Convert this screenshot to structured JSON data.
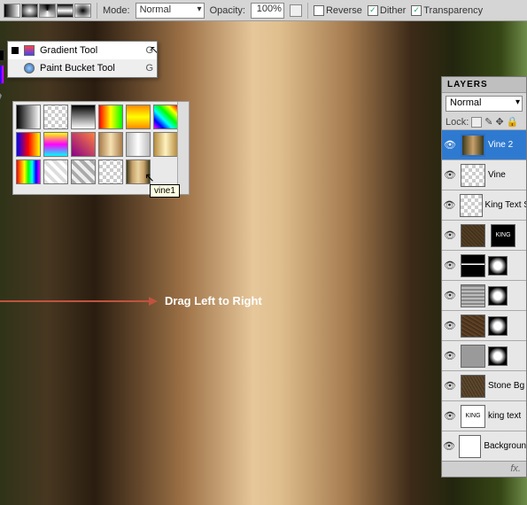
{
  "optionsBar": {
    "modeLabel": "Mode:",
    "modeValue": "Normal",
    "opacityLabel": "Opacity:",
    "opacityValue": "100%",
    "reverse": {
      "label": "Reverse",
      "checked": false
    },
    "dither": {
      "label": "Dither",
      "checked": true
    },
    "transparency": {
      "label": "Transparency",
      "checked": true
    }
  },
  "toolFlyout": {
    "items": [
      {
        "label": "Gradient Tool",
        "shortcut": "G",
        "selected": true
      },
      {
        "label": "Paint Bucket Tool",
        "shortcut": "G",
        "selected": false
      }
    ]
  },
  "gradientTooltip": "vine1",
  "annotation": "Drag Left to Right",
  "layersPanel": {
    "title": "LAYERS",
    "blendMode": "Normal",
    "lockLabel": "Lock:",
    "layers": [
      {
        "name": "Vine 2",
        "active": true,
        "thumb": "th-vine2",
        "mask": false
      },
      {
        "name": "Vine",
        "active": false,
        "thumb": "th-vine",
        "mask": false
      },
      {
        "name": "King Text S",
        "active": false,
        "thumb": "th-king",
        "mask": false
      },
      {
        "name": "",
        "active": false,
        "thumb": "th-tex1",
        "mask": true,
        "mask2": "th-kingb"
      },
      {
        "name": "",
        "active": false,
        "thumb": "th-bar",
        "mask": true
      },
      {
        "name": "",
        "active": false,
        "thumb": "th-lines",
        "mask": true
      },
      {
        "name": "",
        "active": false,
        "thumb": "th-tex2",
        "mask": true
      },
      {
        "name": "",
        "active": false,
        "thumb": "th-gray",
        "mask": true
      },
      {
        "name": "Stone Bg",
        "active": false,
        "thumb": "th-stone",
        "mask": false
      },
      {
        "name": "king text",
        "active": false,
        "thumb": "th-kingt",
        "mask": false
      },
      {
        "name": "Background",
        "active": false,
        "thumb": "th-white",
        "mask": false
      }
    ],
    "footer": "fx."
  }
}
